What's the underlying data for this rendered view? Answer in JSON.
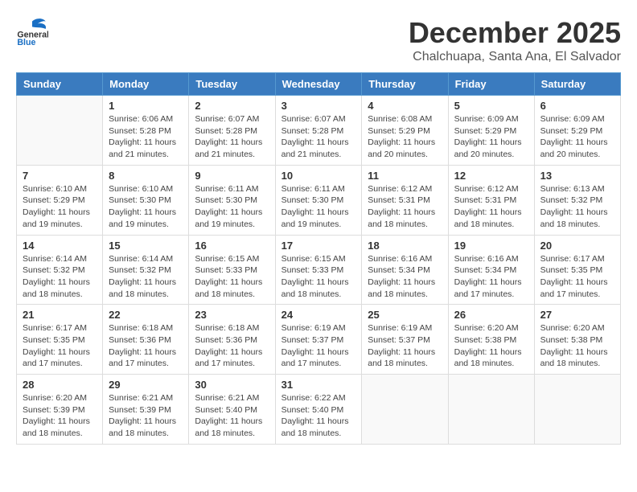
{
  "header": {
    "logo_general": "General",
    "logo_blue": "Blue",
    "month_year": "December 2025",
    "location": "Chalchuapa, Santa Ana, El Salvador"
  },
  "days_of_week": [
    "Sunday",
    "Monday",
    "Tuesday",
    "Wednesday",
    "Thursday",
    "Friday",
    "Saturday"
  ],
  "weeks": [
    [
      {
        "day": "",
        "info": ""
      },
      {
        "day": "1",
        "info": "Sunrise: 6:06 AM\nSunset: 5:28 PM\nDaylight: 11 hours\nand 21 minutes."
      },
      {
        "day": "2",
        "info": "Sunrise: 6:07 AM\nSunset: 5:28 PM\nDaylight: 11 hours\nand 21 minutes."
      },
      {
        "day": "3",
        "info": "Sunrise: 6:07 AM\nSunset: 5:28 PM\nDaylight: 11 hours\nand 21 minutes."
      },
      {
        "day": "4",
        "info": "Sunrise: 6:08 AM\nSunset: 5:29 PM\nDaylight: 11 hours\nand 20 minutes."
      },
      {
        "day": "5",
        "info": "Sunrise: 6:09 AM\nSunset: 5:29 PM\nDaylight: 11 hours\nand 20 minutes."
      },
      {
        "day": "6",
        "info": "Sunrise: 6:09 AM\nSunset: 5:29 PM\nDaylight: 11 hours\nand 20 minutes."
      }
    ],
    [
      {
        "day": "7",
        "info": "Sunrise: 6:10 AM\nSunset: 5:29 PM\nDaylight: 11 hours\nand 19 minutes."
      },
      {
        "day": "8",
        "info": "Sunrise: 6:10 AM\nSunset: 5:30 PM\nDaylight: 11 hours\nand 19 minutes."
      },
      {
        "day": "9",
        "info": "Sunrise: 6:11 AM\nSunset: 5:30 PM\nDaylight: 11 hours\nand 19 minutes."
      },
      {
        "day": "10",
        "info": "Sunrise: 6:11 AM\nSunset: 5:30 PM\nDaylight: 11 hours\nand 19 minutes."
      },
      {
        "day": "11",
        "info": "Sunrise: 6:12 AM\nSunset: 5:31 PM\nDaylight: 11 hours\nand 18 minutes."
      },
      {
        "day": "12",
        "info": "Sunrise: 6:12 AM\nSunset: 5:31 PM\nDaylight: 11 hours\nand 18 minutes."
      },
      {
        "day": "13",
        "info": "Sunrise: 6:13 AM\nSunset: 5:32 PM\nDaylight: 11 hours\nand 18 minutes."
      }
    ],
    [
      {
        "day": "14",
        "info": "Sunrise: 6:14 AM\nSunset: 5:32 PM\nDaylight: 11 hours\nand 18 minutes."
      },
      {
        "day": "15",
        "info": "Sunrise: 6:14 AM\nSunset: 5:32 PM\nDaylight: 11 hours\nand 18 minutes."
      },
      {
        "day": "16",
        "info": "Sunrise: 6:15 AM\nSunset: 5:33 PM\nDaylight: 11 hours\nand 18 minutes."
      },
      {
        "day": "17",
        "info": "Sunrise: 6:15 AM\nSunset: 5:33 PM\nDaylight: 11 hours\nand 18 minutes."
      },
      {
        "day": "18",
        "info": "Sunrise: 6:16 AM\nSunset: 5:34 PM\nDaylight: 11 hours\nand 18 minutes."
      },
      {
        "day": "19",
        "info": "Sunrise: 6:16 AM\nSunset: 5:34 PM\nDaylight: 11 hours\nand 17 minutes."
      },
      {
        "day": "20",
        "info": "Sunrise: 6:17 AM\nSunset: 5:35 PM\nDaylight: 11 hours\nand 17 minutes."
      }
    ],
    [
      {
        "day": "21",
        "info": "Sunrise: 6:17 AM\nSunset: 5:35 PM\nDaylight: 11 hours\nand 17 minutes."
      },
      {
        "day": "22",
        "info": "Sunrise: 6:18 AM\nSunset: 5:36 PM\nDaylight: 11 hours\nand 17 minutes."
      },
      {
        "day": "23",
        "info": "Sunrise: 6:18 AM\nSunset: 5:36 PM\nDaylight: 11 hours\nand 17 minutes."
      },
      {
        "day": "24",
        "info": "Sunrise: 6:19 AM\nSunset: 5:37 PM\nDaylight: 11 hours\nand 17 minutes."
      },
      {
        "day": "25",
        "info": "Sunrise: 6:19 AM\nSunset: 5:37 PM\nDaylight: 11 hours\nand 18 minutes."
      },
      {
        "day": "26",
        "info": "Sunrise: 6:20 AM\nSunset: 5:38 PM\nDaylight: 11 hours\nand 18 minutes."
      },
      {
        "day": "27",
        "info": "Sunrise: 6:20 AM\nSunset: 5:38 PM\nDaylight: 11 hours\nand 18 minutes."
      }
    ],
    [
      {
        "day": "28",
        "info": "Sunrise: 6:20 AM\nSunset: 5:39 PM\nDaylight: 11 hours\nand 18 minutes."
      },
      {
        "day": "29",
        "info": "Sunrise: 6:21 AM\nSunset: 5:39 PM\nDaylight: 11 hours\nand 18 minutes."
      },
      {
        "day": "30",
        "info": "Sunrise: 6:21 AM\nSunset: 5:40 PM\nDaylight: 11 hours\nand 18 minutes."
      },
      {
        "day": "31",
        "info": "Sunrise: 6:22 AM\nSunset: 5:40 PM\nDaylight: 11 hours\nand 18 minutes."
      },
      {
        "day": "",
        "info": ""
      },
      {
        "day": "",
        "info": ""
      },
      {
        "day": "",
        "info": ""
      }
    ]
  ]
}
